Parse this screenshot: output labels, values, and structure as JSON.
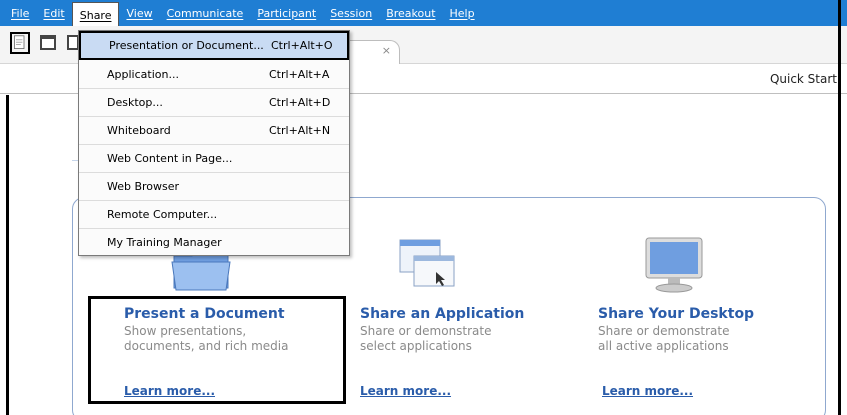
{
  "menubar": {
    "items": [
      "File",
      "Edit",
      "Share",
      "View",
      "Communicate",
      "Participant",
      "Session",
      "Breakout",
      "Help"
    ],
    "active": "Share"
  },
  "toolbar": {
    "tab_close": "×"
  },
  "quick_start_label": "Quick Start",
  "share_menu": {
    "items": [
      {
        "label": "Presentation or Document...",
        "shortcut": "Ctrl+Alt+O",
        "highlighted": true
      },
      {
        "label": "Application...",
        "shortcut": "Ctrl+Alt+A"
      },
      {
        "label": "Desktop...",
        "shortcut": "Ctrl+Alt+D"
      },
      {
        "label": "Whiteboard",
        "shortcut": "Ctrl+Alt+N"
      },
      {
        "label": "Web Content in Page...",
        "shortcut": ""
      },
      {
        "label": "Web Browser",
        "shortcut": ""
      },
      {
        "label": "Remote Computer...",
        "shortcut": ""
      },
      {
        "label": "My Training Manager",
        "shortcut": ""
      }
    ]
  },
  "cards": [
    {
      "title": "Present a Document",
      "desc1": "Show presentations,",
      "desc2": "documents, and rich media",
      "learn": "Learn more..."
    },
    {
      "title": "Share an Application",
      "desc1": "Share or demonstrate",
      "desc2": "select applications",
      "learn": "Learn more..."
    },
    {
      "title": "Share Your Desktop",
      "desc1": "Share or demonstrate",
      "desc2": "all active applications",
      "learn": "Learn more..."
    }
  ],
  "colors": {
    "menubar_bg": "#1f7ed3",
    "card_title": "#2a5caa",
    "menu_highlight": "#c9dbf3"
  }
}
